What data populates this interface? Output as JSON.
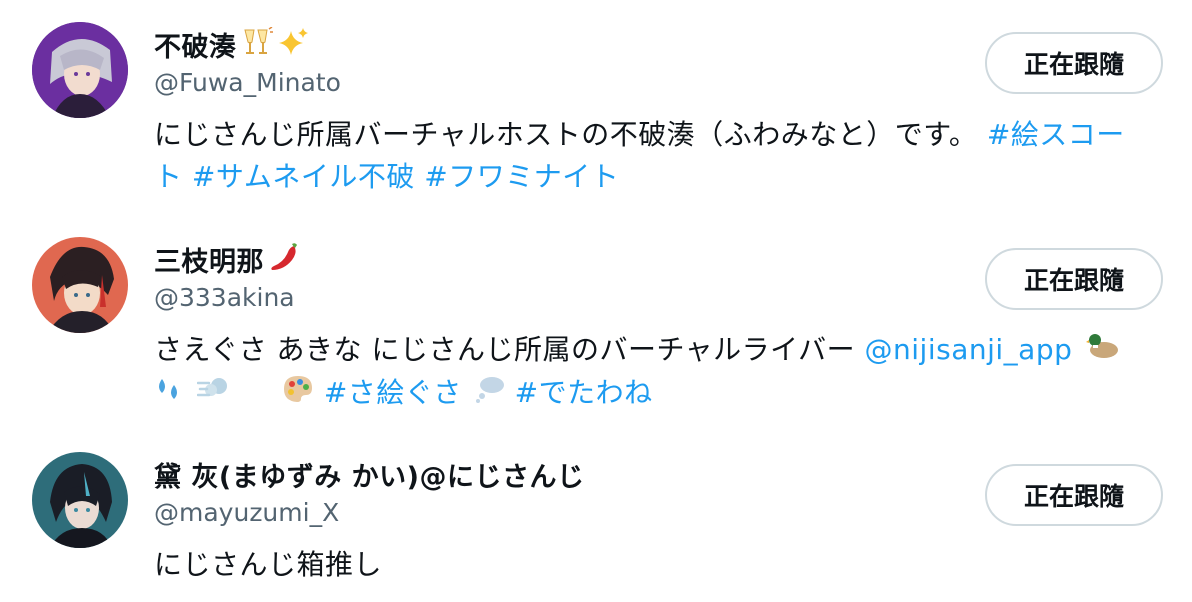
{
  "follow_button_label": "正在跟隨",
  "colors": {
    "link": "#1d9bf0",
    "handle": "#536471",
    "text": "#0f1419",
    "button_border": "#cfd9de"
  },
  "users": [
    {
      "display_name": "不破湊",
      "name_emojis": [
        "clinking-glasses-icon",
        "sparkles-icon"
      ],
      "handle": "@Fuwa_Minato",
      "bio_text": "にじさんじ所属バーチャルホストの不破湊（ふわみなと）です。",
      "bio_hashtags": [
        "#絵スコート",
        "#サムネイル不破",
        "#フワミナイト"
      ]
    },
    {
      "display_name": "三枝明那",
      "name_emojis": [
        "hot-pepper-icon"
      ],
      "handle": "@333akina",
      "bio_text": "さえぐさ あきな にじさんじ所属のバーチャルライバー",
      "bio_mention": "@nijisanji_app",
      "bio_emojis": [
        "duck-icon",
        "sweat-droplets-icon",
        "dash-icon",
        "palette-icon"
      ],
      "bio_hashtag_1": "#さ絵ぐさ",
      "bio_emoji_mid": "thought-balloon-icon",
      "bio_hashtag_2": "#でたわね"
    },
    {
      "display_name": "黛 灰(まゆずみ かい)@にじさんじ",
      "handle": "@mayuzumi_X",
      "bio_text": "にじさんじ箱推し"
    }
  ]
}
